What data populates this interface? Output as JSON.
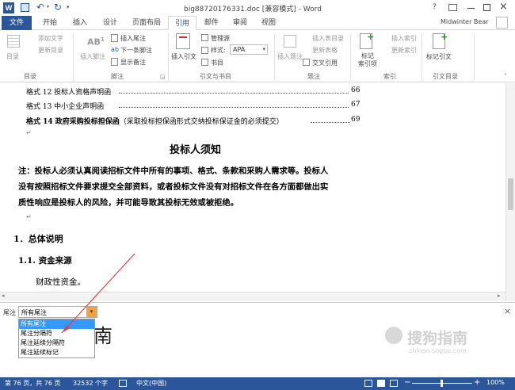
{
  "window": {
    "title": "big88720176331.doc [兼容模式] - Word",
    "help": "?",
    "user": "Midwinter Bear"
  },
  "tabs": [
    {
      "label": "文件"
    },
    {
      "label": "开始"
    },
    {
      "label": "插入"
    },
    {
      "label": "设计"
    },
    {
      "label": "页面布局"
    },
    {
      "label": "引用"
    },
    {
      "label": "邮件"
    },
    {
      "label": "审阅"
    },
    {
      "label": "视图"
    }
  ],
  "ribbon": {
    "toc": {
      "big": "目录",
      "add_text": "添加文字",
      "update": "更新目录",
      "group": "目录"
    },
    "footnotes": {
      "insert_footnote": "插入脚注",
      "ab": "AB",
      "sup": "1",
      "insert_endnote": "插入尾注",
      "next_footnote": "下一条脚注",
      "show_notes": "显示备注",
      "group": "脚注"
    },
    "citations": {
      "insert_citation": "插入引文",
      "manage_sources": "管理源",
      "style_label": "样式:",
      "style_value": "APA",
      "bibliography": "书目",
      "group": "引文与书目"
    },
    "captions": {
      "insert_caption": "插入题注",
      "insert_table_of_figures": "插入表目录",
      "update_table": "更新表格",
      "cross_reference": "交叉引用",
      "group": "题注"
    },
    "index": {
      "mark_entry": "标记\n索引项",
      "insert_index": "插入索引",
      "update_index": "更新索引",
      "group": "索引"
    },
    "authorities": {
      "mark_citation": "标记引文",
      "group": "引文目录"
    }
  },
  "document": {
    "toc_lines": [
      {
        "text": "格式 12 投标人资格声明函",
        "page": "66"
      },
      {
        "text": "格式 13 中小企业声明函",
        "page": "67"
      },
      {
        "text": "格式 14 政府采购投标担保函",
        "suffix": "（采取投标担保函形式交纳投标保证金的必须提交）",
        "page": "69"
      }
    ],
    "heading": "投标人须知",
    "note_lines": [
      "注：投标人必须认真阅读招标文件中所有的事项、格式、条款和采购人需求等。投标人",
      "没有按照招标文件要求提交全部资料，或者投标文件没有对招标文件在各方面都做出实",
      "质性响应是投标人的风险，并可能导致其投标无效或被拒绝。"
    ],
    "section1": "1．总体说明",
    "section11": "1.1. 资金来源",
    "body": "财政性资金。"
  },
  "footnote_pane": {
    "label": "尾注",
    "select_value": "所有尾注",
    "options": [
      "所有尾注",
      "尾注分隔符",
      "尾注延续分隔符",
      "尾注延续标记"
    ],
    "behind_text": "南",
    "close": "×",
    "watermark": "搜狗指南",
    "watermark_url": "zhinan.sogou.com"
  },
  "status": {
    "page": "第 76 页，共 76 页",
    "words": "32532 个字",
    "lang": "中文(中国)",
    "zoom": "100%",
    "minus": "−",
    "plus": "+"
  },
  "colors": {
    "accent": "#2b579a",
    "select_yellow": "#f2a33a",
    "highlight": "#3399ff"
  }
}
